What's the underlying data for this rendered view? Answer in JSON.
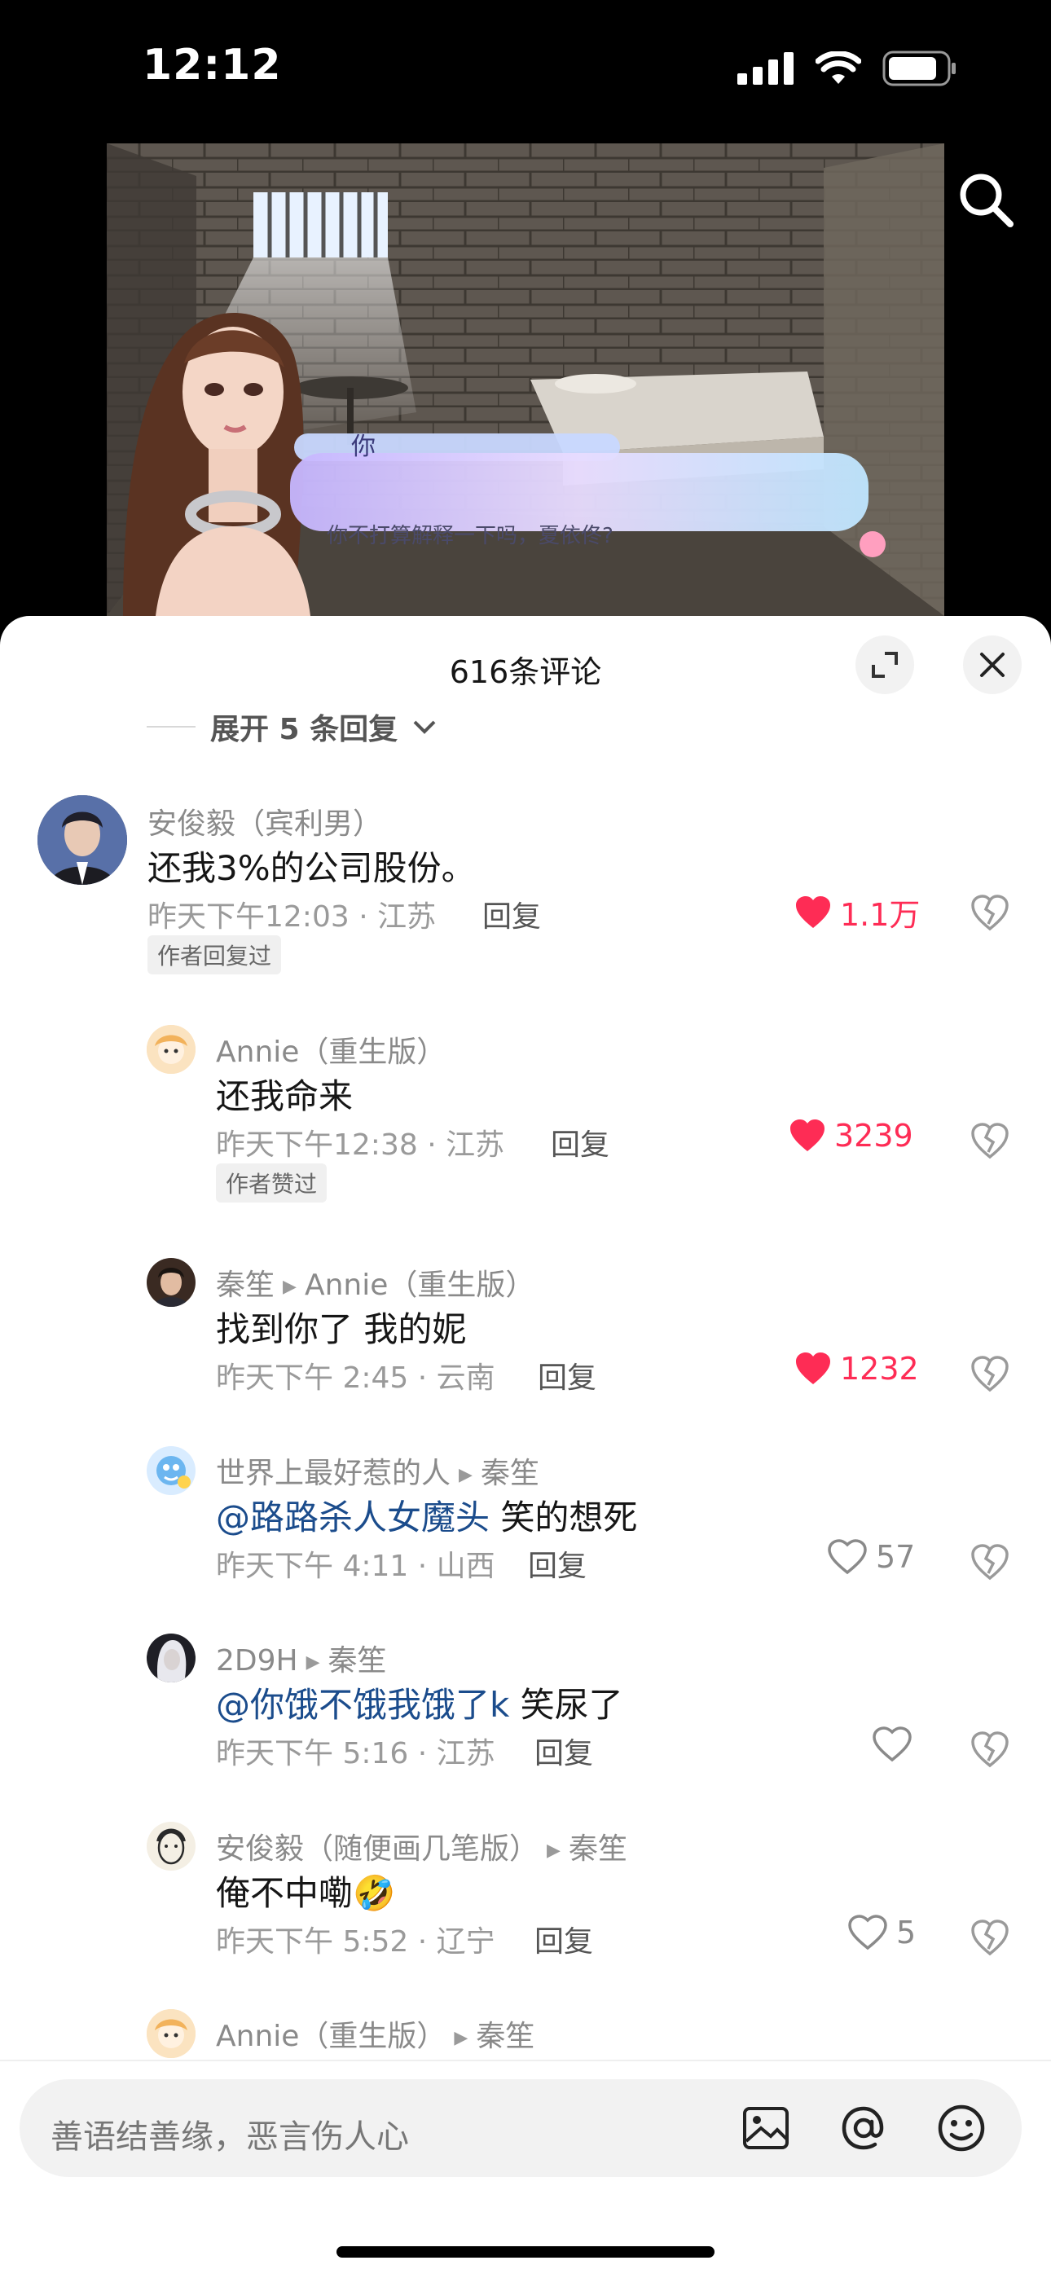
{
  "status_bar": {
    "time": "12:12"
  },
  "video": {
    "speaker": "你",
    "dialogue": "你不打算解释一下吗，夏依佟?"
  },
  "sheet": {
    "title": "616条评论",
    "expand_label": "展开 5 条回复"
  },
  "comments": [
    {
      "name": "安俊毅（宾利男）",
      "text": "还我3%的公司股份。",
      "meta": "昨天下午12:03 · 江苏",
      "reply": "回复",
      "likes": "1.1万",
      "liked": true,
      "badge": "作者回复过"
    },
    {
      "name": "Annie（重生版）",
      "text": "还我命来",
      "meta": "昨天下午12:38 · 江苏",
      "reply": "回复",
      "likes": "3239",
      "liked": true,
      "badge": "作者赞过"
    },
    {
      "name": "秦笙",
      "to": "Annie（重生版）",
      "text": "找到你了 我的妮",
      "meta": "昨天下午 2:45 · 云南",
      "reply": "回复",
      "likes": "1232",
      "liked": true
    },
    {
      "name": "世界上最好惹的人",
      "to": "秦笙",
      "mention": "@路路杀人女魔头",
      "text": " 笑的想死",
      "meta": "昨天下午 4:11 · 山西",
      "reply": "回复",
      "likes": "57",
      "liked": false
    },
    {
      "name": "2D9H",
      "to": "秦笙",
      "mention": "@你饿不饿我饿了k",
      "text": " 笑尿了",
      "meta": "昨天下午 5:16 · 江苏",
      "reply": "回复",
      "likes": "",
      "liked": false
    },
    {
      "name": "安俊毅（随便画几笔版）",
      "to": "秦笙",
      "text": "俺不中嘞🤣",
      "meta": "昨天下午 5:52 · 辽宁",
      "reply": "回复",
      "likes": "5",
      "liked": false
    },
    {
      "name": "Annie（重生版）",
      "to": "秦笙"
    }
  ],
  "input": {
    "placeholder": "善语结善缘，恶言伤人心"
  }
}
